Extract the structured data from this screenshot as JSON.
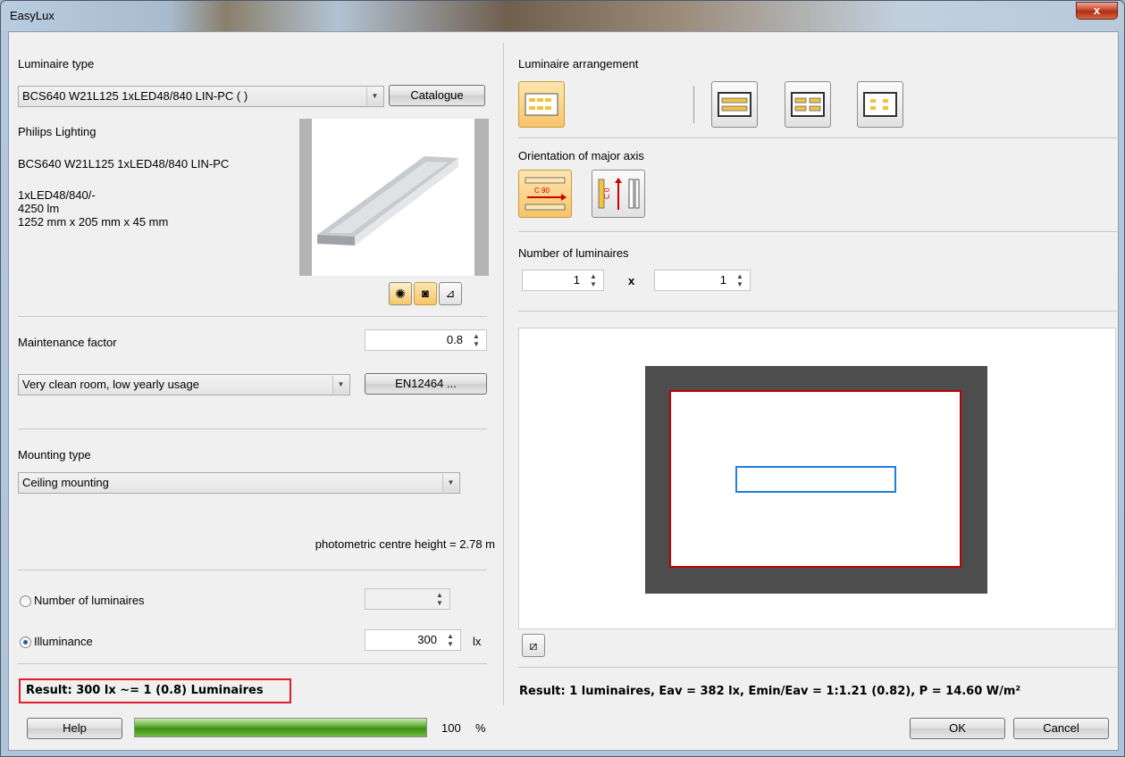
{
  "window": {
    "title": "EasyLux",
    "close_glyph": "x"
  },
  "luminaire_type": {
    "label": "Luminaire type",
    "selected": "BCS640 W21L125 1xLED48/840 LIN-PC ( )",
    "catalogue_button": "Catalogue",
    "manufacturer": "Philips Lighting",
    "name": "BCS640 W21L125 1xLED48/840 LIN-PC",
    "lamp": "1xLED48/840/-",
    "flux": "4250 lm",
    "dimensions": "1252 mm x 205 mm x 45 mm"
  },
  "maintenance": {
    "label": "Maintenance factor",
    "value": "0.8",
    "condition": "Very clean room, low yearly usage",
    "standard_button": "EN12464 ..."
  },
  "mounting": {
    "label": "Mounting type",
    "selected": "Ceiling mounting",
    "photometric_height": "photometric centre height = 2.78 m"
  },
  "calc_mode": {
    "number_label": "Number of luminaires",
    "number_value": "",
    "illuminance_label": "Illuminance",
    "illuminance_value": "300",
    "illuminance_unit": "lx",
    "selected": "illuminance"
  },
  "result_left": "Result: 300 lx ~= 1 (0.8) Luminaires",
  "arrangement": {
    "label": "Luminaire arrangement"
  },
  "orientation": {
    "label": "Orientation of major axis",
    "c90_label": "C 90",
    "c0_label": "C 0"
  },
  "number_of_luminaires": {
    "label": "Number of luminaires",
    "x_value": "1",
    "separator": "x",
    "y_value": "1"
  },
  "result_right": "Result: 1 luminaires, Eav = 382 lx, Emin/Eav = 1:1.21 (0.82), P = 14.60 W/m²",
  "footer": {
    "help_button": "Help",
    "progress_value": 100,
    "progress_text": "100",
    "progress_unit": "%",
    "ok_button": "OK",
    "cancel_button": "Cancel"
  },
  "colors": {
    "accent_active": "#f8c46a",
    "result_box_border": "#e21b2b",
    "room_border": "#c00000",
    "luminaire_outline": "#1e7fd8",
    "room_wall": "#4d4d4d"
  }
}
